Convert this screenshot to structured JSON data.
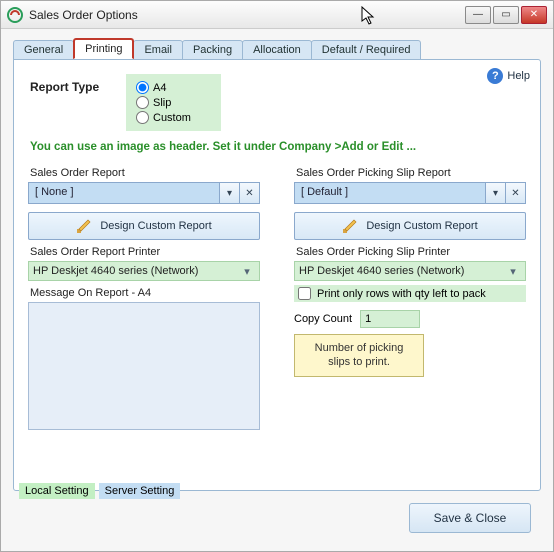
{
  "window": {
    "title": "Sales Order Options"
  },
  "tabs": [
    "General",
    "Printing",
    "Email",
    "Packing",
    "Allocation",
    "Default / Required"
  ],
  "active_tab_index": 1,
  "help_label": "Help",
  "report_type": {
    "label": "Report Type",
    "options": [
      "A4",
      "Slip",
      "Custom"
    ],
    "selected": "A4"
  },
  "header_hint": "You can use an image as header. Set it under  Company >Add or Edit ...",
  "left": {
    "report_label": "Sales Order Report",
    "report_value": "[ None ]",
    "design_btn": "Design Custom Report",
    "printer_label": "Sales Order Report Printer",
    "printer_value": "HP Deskjet 4640 series (Network)",
    "msg_label": "Message On Report - A4",
    "msg_value": ""
  },
  "right": {
    "report_label": "Sales Order Picking Slip Report",
    "report_value": "[ Default ]",
    "design_btn": "Design Custom Report",
    "printer_label": "Sales Order Picking Slip Printer",
    "printer_value": "HP Deskjet 4640 series (Network)",
    "print_only_label": "Print only rows with qty left to pack",
    "print_only_checked": false,
    "copy_count_label": "Copy Count",
    "copy_count_value": "1",
    "tooltip": "Number of picking slips to print."
  },
  "legend": {
    "local": "Local Setting",
    "server": "Server Setting"
  },
  "save_label": "Save & Close"
}
